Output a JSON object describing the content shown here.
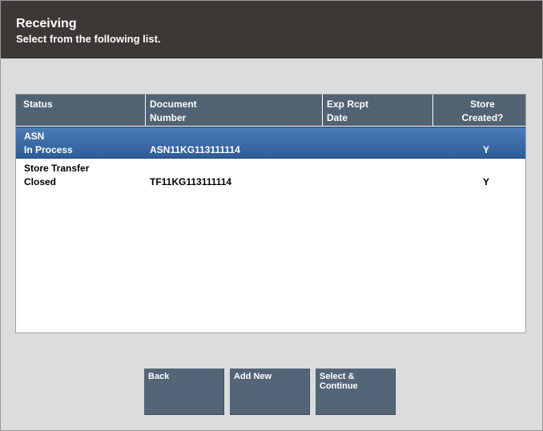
{
  "header": {
    "title": "Receiving",
    "subtitle": "Select from the following list."
  },
  "table": {
    "columns": [
      {
        "line1": "Status",
        "line2": ""
      },
      {
        "line1": "Document",
        "line2": "Number"
      },
      {
        "line1": "Exp Rcpt",
        "line2": "Date"
      },
      {
        "line1": "Store",
        "line2": "Created?"
      }
    ],
    "rows": [
      {
        "status_line1": "ASN",
        "status_line2": "In Process",
        "document_number": "ASN11KG113111114",
        "exp_rcpt_date": "",
        "store_created": "Y",
        "selected": true
      },
      {
        "status_line1": "Store Transfer",
        "status_line2": "Closed",
        "document_number": "TF11KG113111114",
        "exp_rcpt_date": "",
        "store_created": "Y",
        "selected": false
      }
    ]
  },
  "buttons": {
    "back": "Back",
    "add_new": "Add New",
    "select_continue": "Select &\nContinue"
  }
}
